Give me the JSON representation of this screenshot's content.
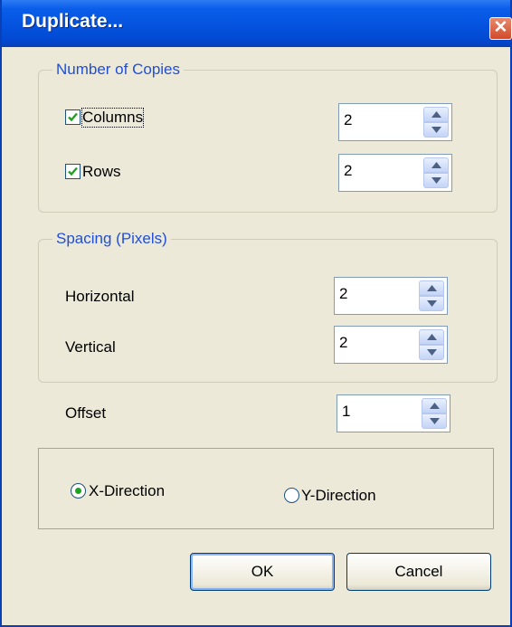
{
  "window": {
    "title": "Duplicate...",
    "close_glyph": "✕"
  },
  "number_of_copies": {
    "legend": "Number of Copies",
    "columns": {
      "label": "Columns",
      "checked": true,
      "value": "2"
    },
    "rows": {
      "label": "Rows",
      "checked": true,
      "value": "2"
    }
  },
  "spacing": {
    "legend": "Spacing (Pixels)",
    "horizontal": {
      "label": "Horizontal",
      "value": "2"
    },
    "vertical": {
      "label": "Vertical",
      "value": "2"
    }
  },
  "offset": {
    "label": "Offset",
    "value": "1"
  },
  "direction": {
    "x_label": "X-Direction",
    "y_label": "Y-Direction",
    "selected": "X-Direction"
  },
  "buttons": {
    "ok": "OK",
    "cancel": "Cancel"
  },
  "colors": {
    "titlebar": "#0554e0",
    "legend_text": "#1f4fd8",
    "dialog_bg": "#ece9d8",
    "check_mark": "#21a121"
  }
}
